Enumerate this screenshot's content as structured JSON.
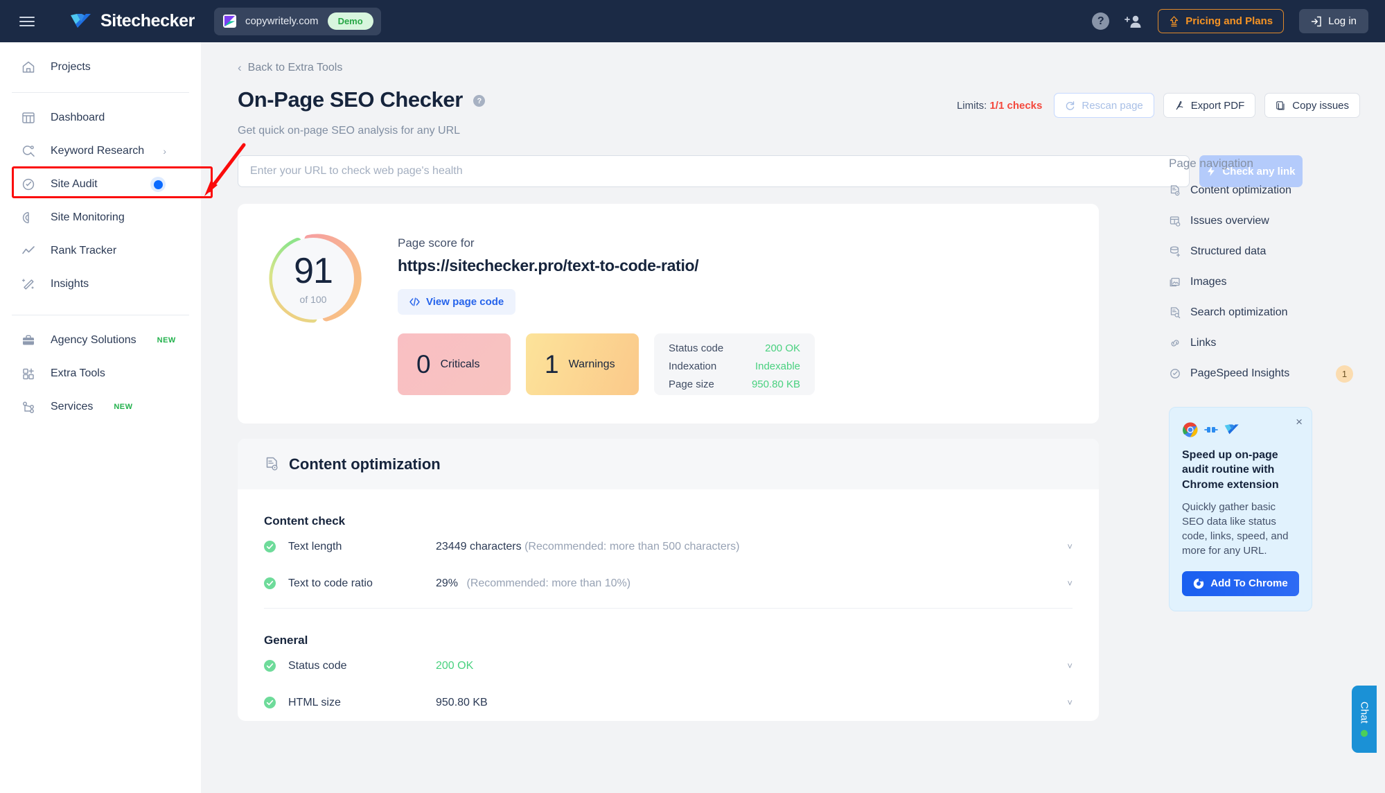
{
  "topbar": {
    "menu_icon": "hamburger-icon",
    "brand": "Sitechecker",
    "site_name": "copywritely.com",
    "demo_badge": "Demo",
    "help_icon": "question-mark-icon",
    "invite_icon": "add-user-icon",
    "pricing_label": "Pricing and Plans",
    "login_label": "Log in"
  },
  "sidebar": {
    "group1": [
      {
        "label": "Projects",
        "icon": "home-icon"
      }
    ],
    "group2": [
      {
        "label": "Dashboard",
        "icon": "dashboard-grid-icon"
      },
      {
        "label": "Keyword Research",
        "icon": "keyword-search-icon",
        "chevron": "›"
      },
      {
        "label": "Site Audit",
        "icon": "gauge-icon",
        "active": true
      },
      {
        "label": "Site Monitoring",
        "icon": "radar-icon"
      },
      {
        "label": "Rank Tracker",
        "icon": "line-chart-icon"
      },
      {
        "label": "Insights",
        "icon": "magic-wand-icon"
      }
    ],
    "group3": [
      {
        "label": "Agency Solutions",
        "icon": "briefcase-icon",
        "tag": "NEW"
      },
      {
        "label": "Extra Tools",
        "icon": "apps-plus-icon"
      },
      {
        "label": "Services",
        "icon": "share-nodes-icon",
        "tag": "NEW"
      }
    ]
  },
  "page": {
    "breadcrumb": "Back to Extra Tools",
    "title": "On-Page SEO Checker",
    "subtitle": "Get quick on-page SEO analysis for any URL",
    "limits_prefix": "Limits:",
    "limits_value": "1/1 checks",
    "rescan_label": "Rescan page",
    "export_label": "Export PDF",
    "copy_label": "Copy issues"
  },
  "search": {
    "placeholder": "Enter your URL to check web page's health",
    "value": "",
    "button_label": "Check any link"
  },
  "score": {
    "value": "91",
    "of": "of 100",
    "label": "Page score for",
    "url": "https://sitechecker.pro/text-to-code-ratio/",
    "view_code_label": "View page code",
    "criticals_count": "0",
    "criticals_label": "Criticals",
    "warnings_count": "1",
    "warnings_label": "Warnings",
    "info": [
      {
        "key": "Status code",
        "value": "200 OK"
      },
      {
        "key": "Indexation",
        "value": "Indexable"
      },
      {
        "key": "Page size",
        "value": "950.80 KB"
      }
    ]
  },
  "content_section": {
    "heading": "Content optimization",
    "groups": [
      {
        "title": "Content check",
        "rows": [
          {
            "name": "Text length",
            "value": "23449 characters",
            "note": "(Recommended: more than 500 characters)",
            "status": "ok"
          },
          {
            "name": "Text to code ratio",
            "value": "29%",
            "note": "(Recommended: more than 10%)",
            "status": "ok"
          }
        ]
      },
      {
        "title": "General",
        "rows": [
          {
            "name": "Status code",
            "value": "200 OK",
            "note": "",
            "status": "ok",
            "green": true
          },
          {
            "name": "HTML size",
            "value": "950.80 KB",
            "note": "",
            "status": "ok"
          }
        ]
      }
    ]
  },
  "rail": {
    "title": "Page navigation",
    "items": [
      {
        "label": "Content optimization",
        "icon": "doc-gear-icon"
      },
      {
        "label": "Issues overview",
        "icon": "layout-issues-icon"
      },
      {
        "label": "Structured data",
        "icon": "database-icon"
      },
      {
        "label": "Images",
        "icon": "image-icon"
      },
      {
        "label": "Search optimization",
        "icon": "doc-search-icon"
      },
      {
        "label": "Links",
        "icon": "link-chain-icon"
      },
      {
        "label": "PageSpeed Insights",
        "icon": "gauge-icon",
        "badge": "1"
      }
    ]
  },
  "promo": {
    "close_icon": "close-icon",
    "title": "Speed up on-page audit routine with Chrome extension",
    "desc": "Quickly gather basic SEO data like status code, links, speed, and more for any URL.",
    "button_label": "Add To Chrome"
  },
  "chat": {
    "label": "Chat"
  },
  "colors": {
    "topbar_bg": "#1b2a45",
    "accent_blue": "#0a6aff",
    "pricing_orange": "#f59324",
    "success_green": "#49d17f",
    "critical_red": "#f4473c",
    "annotation_red": "#fb0b0b",
    "chat_blue": "#1b91d6"
  }
}
